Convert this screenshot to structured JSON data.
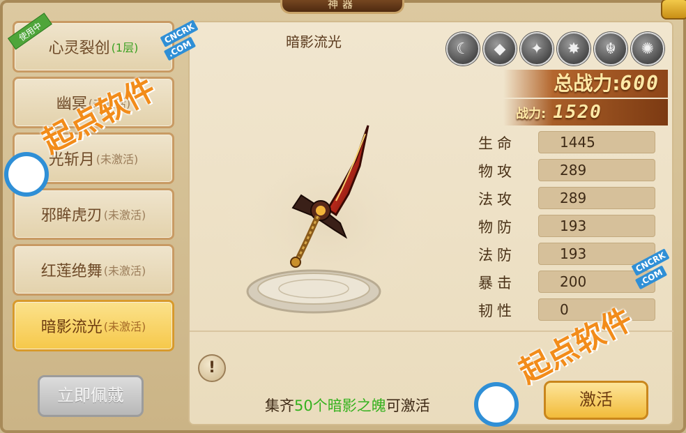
{
  "window": {
    "title": "神器"
  },
  "sidebar": {
    "items": [
      {
        "name": "心灵裂创",
        "status": "(1层)",
        "badge": "使用中"
      },
      {
        "name": "幽冥",
        "status": "(未激活)"
      },
      {
        "name": "光斩月",
        "status": "(未激活)"
      },
      {
        "name": "邪眸虎刃",
        "status": "(未激活)"
      },
      {
        "name": "红莲绝舞",
        "status": "(未激活)"
      },
      {
        "name": "暗影流光",
        "status": "(未激活)"
      }
    ],
    "wear_label": "立即佩戴"
  },
  "main": {
    "weapon_name": "暗影流光",
    "skills": [
      "moon-icon",
      "crystal-icon",
      "dragon-icon",
      "flame-icon",
      "demon-mask-icon",
      "beast-icon"
    ],
    "total_power_label": "总战力:",
    "total_power_value": "600",
    "power_label": "战力:",
    "power_value": "1520",
    "stats": [
      {
        "label": "生命",
        "value": "1445"
      },
      {
        "label": "物攻",
        "value": "289"
      },
      {
        "label": "法攻",
        "value": "289"
      },
      {
        "label": "物防",
        "value": "193"
      },
      {
        "label": "法防",
        "value": "193"
      },
      {
        "label": "暴击",
        "value": "200"
      },
      {
        "label": "韧性",
        "value": "0"
      }
    ],
    "hint_prefix": "集齐",
    "hint_highlight": "50个暗影之魄",
    "hint_suffix": "可激活",
    "activate_label": "激活"
  },
  "watermark": {
    "text": "起点软件",
    "tag1": "CNCRK",
    "tag2": ".COM"
  },
  "colors": {
    "accent_green": "#35b11e",
    "selected_item": "#f6c84a",
    "power_text": "#ffe9a6"
  }
}
